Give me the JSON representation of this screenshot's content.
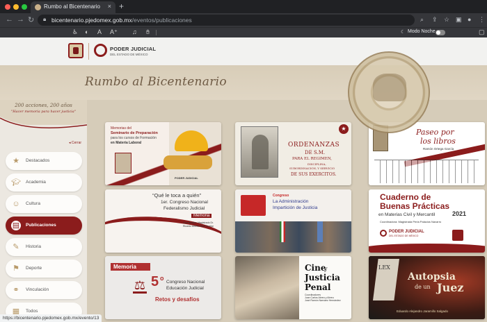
{
  "browser": {
    "tab_title": "Rumbo al Bicentenario",
    "url_host": "bicentenario.pjedomex.gob.mx",
    "url_path": "/eventos/publicaciones",
    "night_mode_label": "Modo Noche",
    "status_url": "https://bicentenario.pjedomex.gob.mx/evento/13"
  },
  "header": {
    "org_name": "PODER JUDICIAL",
    "org_sub": "DEL ESTADO DE MÉXICO"
  },
  "banner": {
    "title": "Rumbo al Bicentenario",
    "tagline": "200 acciones, 200 años",
    "motto": "\"Hacer memoria para hacer justicia\""
  },
  "sidebar": {
    "close_label": "Cerrar",
    "items": [
      {
        "label": "Destacados",
        "icon": "star-icon"
      },
      {
        "label": "Academia",
        "icon": "graduation-cap-icon"
      },
      {
        "label": "Cultura",
        "icon": "drama-mask-icon"
      },
      {
        "label": "Publicaciones",
        "icon": "book-icon",
        "active": true
      },
      {
        "label": "Historia",
        "icon": "scroll-icon"
      },
      {
        "label": "Deporte",
        "icon": "running-icon"
      },
      {
        "label": "Vinculación",
        "icon": "handshake-icon"
      },
      {
        "label": "Todos",
        "icon": "grid-icon"
      }
    ]
  },
  "cards": {
    "c1": {
      "l1": "Memorias del",
      "l2": "Seminario de Preparación",
      "l3": "para los cursos de Formación",
      "l4": "en Materia Laboral",
      "logo": "PODER JUDICIAL"
    },
    "c2": {
      "l1": "ORDENANZAS",
      "l2": "DE S.M.",
      "l3": "PARA EL REGIMEN,",
      "l4": "DISCIPLINA,",
      "l5": "SUBORDINACION, Y SERVICIO",
      "l6": "DE SUS EXERCITOS."
    },
    "c3": {
      "l1": "Paseo por",
      "l2": "los libros",
      "l3": "Ramón Ortega García"
    },
    "c4": {
      "l1": "“Qué le toca a quién”",
      "l2": "1er. Congreso Nacional",
      "l3": "Federalismo Judicial",
      "badge": "Memoria",
      "l4": "Coordinador: Magistrado Dr.",
      "l5": "Ricardo Alfredo Sodi Cuellar"
    },
    "c5": {
      "l1": "Congreso",
      "l2": "La Administración",
      "l3": "Impartición de Justicia"
    },
    "c6": {
      "l1": "Cuaderno de",
      "l2": "Buenas Prácticas",
      "l3": "en Materias Civil y Mercantil",
      "year": "2021",
      "l4": "Coordinadora: Magistrada Perla Palacios Navarro",
      "logo": "PODER JUDICIAL",
      "logo_sub": "DEL ESTADO DE MÉXICO"
    },
    "c7": {
      "badge": "Memoria",
      "num": "5",
      "deg": "o",
      "l1": "Congreso Nacional",
      "l2": "Educación Judicial",
      "l3": "Retos y desafíos"
    },
    "c8": {
      "l1": "Cine",
      "l1b": "y",
      "l2": "Justicia",
      "l3": "Penal",
      "l4": "Coordinadores",
      "l5": "Juan Carlos Abreu y Abreu",
      "l6": "José Ramón Narváez Hernández"
    },
    "c9": {
      "l1": "Autopsia",
      "l2": "de un",
      "l3": "Juez",
      "l4": "Eduardo Alejandro Jaramillo Salgado",
      "lex": "LEX"
    }
  }
}
